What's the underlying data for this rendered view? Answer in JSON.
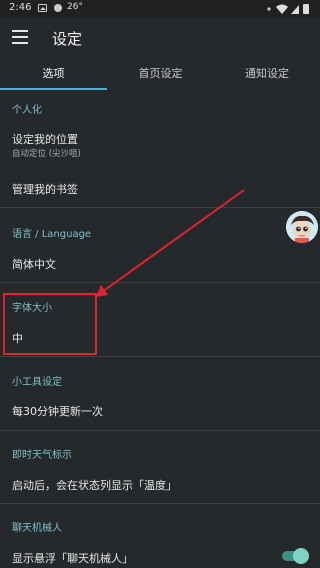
{
  "status": {
    "time": "2:46",
    "temperature": "26°"
  },
  "appbar": {
    "title": "设定"
  },
  "tabs": [
    {
      "label": "选项"
    },
    {
      "label": "首页设定"
    },
    {
      "label": "通知设定"
    }
  ],
  "personalization": {
    "header": "个人化",
    "location_title": "设定我的位置",
    "location_sub": "自动定位 (尖沙咀)",
    "bookmarks_title": "管理我的书签"
  },
  "language": {
    "header": "语言 / Language",
    "value": "简体中文"
  },
  "font_size": {
    "header": "字体大小",
    "value": "中"
  },
  "widget": {
    "header": "小工具设定",
    "value": "每30分钟更新一次"
  },
  "instant_weather": {
    "header": "即时天气标示",
    "value": "启动后，会在状态列显示「温度」"
  },
  "chatbot": {
    "header": "聊天机械人",
    "toggle_label": "显示悬浮「聊天机械人」",
    "toggle_on": true
  },
  "colors": {
    "accent": "#54b0d0",
    "section_header": "#7fc0c8",
    "annotation": "#e0242f",
    "toggle": "#7fd3c4"
  }
}
